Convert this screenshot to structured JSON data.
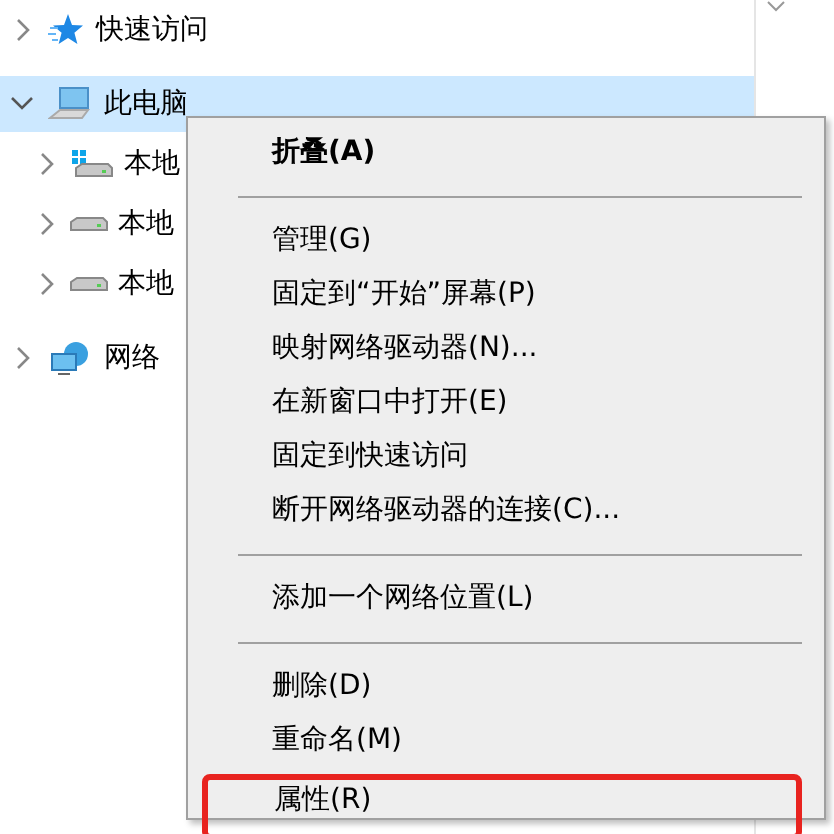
{
  "navigation": {
    "items": [
      {
        "label": "快速访问",
        "expanded": false,
        "selected": false
      },
      {
        "label": "此电脑",
        "expanded": true,
        "selected": true,
        "children": [
          {
            "label": "本地",
            "expanded": false,
            "selected": false
          },
          {
            "label": "本地",
            "expanded": false,
            "selected": false
          },
          {
            "label": "本地",
            "expanded": false,
            "selected": false
          }
        ]
      },
      {
        "label": "网络",
        "expanded": false,
        "selected": false
      }
    ]
  },
  "context_menu": {
    "items": [
      {
        "kind": "item",
        "label": "折叠(A)",
        "default": true,
        "highlighted": false
      },
      {
        "kind": "separator"
      },
      {
        "kind": "item",
        "label": "管理(G)",
        "default": false,
        "highlighted": false
      },
      {
        "kind": "item",
        "label": "固定到“开始”屏幕(P)",
        "default": false,
        "highlighted": false
      },
      {
        "kind": "item",
        "label": "映射网络驱动器(N)...",
        "default": false,
        "highlighted": false
      },
      {
        "kind": "item",
        "label": "在新窗口中打开(E)",
        "default": false,
        "highlighted": false
      },
      {
        "kind": "item",
        "label": "固定到快速访问",
        "default": false,
        "highlighted": false
      },
      {
        "kind": "item",
        "label": "断开网络驱动器的连接(C)...",
        "default": false,
        "highlighted": false
      },
      {
        "kind": "separator"
      },
      {
        "kind": "item",
        "label": "添加一个网络位置(L)",
        "default": false,
        "highlighted": false
      },
      {
        "kind": "separator"
      },
      {
        "kind": "item",
        "label": "删除(D)",
        "default": false,
        "highlighted": false
      },
      {
        "kind": "item",
        "label": "重命名(M)",
        "default": false,
        "highlighted": false
      },
      {
        "kind": "item",
        "label": "属性(R)",
        "default": false,
        "highlighted": true
      }
    ]
  }
}
